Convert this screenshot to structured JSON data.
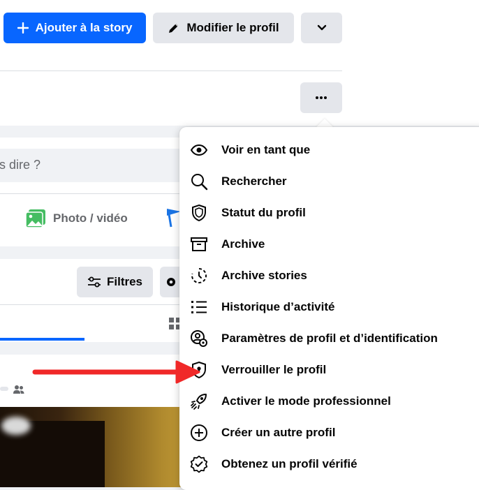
{
  "header": {
    "add_story_label": "Ajouter à la story",
    "edit_profile_label": "Modifier le profil"
  },
  "composer": {
    "placeholder_fragment": "s dire ?",
    "photo_video_label": "Photo / vidéo"
  },
  "posts": {
    "filters_label": "Filtres"
  },
  "menu": {
    "items": [
      {
        "label": "Voir en tant que",
        "icon": "eye-icon"
      },
      {
        "label": "Rechercher",
        "icon": "search-icon"
      },
      {
        "label": "Statut du profil",
        "icon": "shield-icon"
      },
      {
        "label": "Archive",
        "icon": "archive-icon"
      },
      {
        "label": "Archive stories",
        "icon": "clock-history-icon"
      },
      {
        "label": "Historique d’activité",
        "icon": "list-icon"
      },
      {
        "label": "Paramètres de profil et d’identification",
        "icon": "profile-settings-icon"
      },
      {
        "label": "Verrouiller le profil",
        "icon": "lock-shield-icon"
      },
      {
        "label": "Activer le mode professionnel",
        "icon": "rocket-icon"
      },
      {
        "label": "Créer un autre profil",
        "icon": "plus-circle-icon"
      },
      {
        "label": "Obtenez un profil vérifié",
        "icon": "verified-badge-icon"
      }
    ]
  },
  "colors": {
    "primary_blue": "#0866ff",
    "annotation_red": "#f02828",
    "button_gray": "#e4e6eb"
  }
}
